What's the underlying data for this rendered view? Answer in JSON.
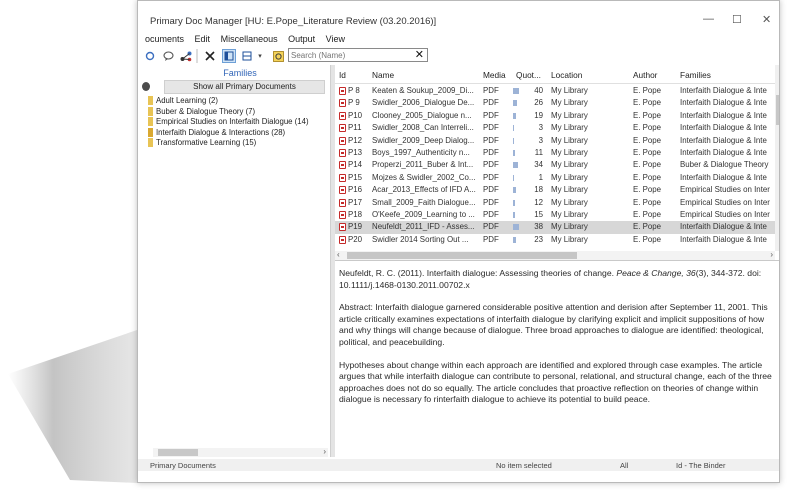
{
  "window": {
    "title": "Primary Doc Manager [HU: E.Pope_Literature Review (03.20.2016)]",
    "controls": {
      "minimize": "—",
      "maximize": "☐",
      "close": "✕"
    }
  },
  "menu": {
    "items": [
      "ocuments",
      "Edit",
      "Miscellaneous",
      "Output",
      "View"
    ]
  },
  "toolbar": {
    "search_placeholder": "Search (Name)",
    "search_clear": "✕",
    "accent": "#3266b8"
  },
  "families": {
    "header": "Families",
    "show_all": "Show all Primary Documents",
    "items": [
      "Adult Learning (2)",
      "Buber & Dialogue Theory (7)",
      "Empirical Studies on Interfaith Dialogue (14)",
      "Interfaith Dialogue & Interactions (28)",
      "Transformative Learning (15)"
    ]
  },
  "grid": {
    "columns": [
      "Id",
      "Name",
      "Media",
      "Quot...",
      "Location",
      "Author",
      "Families"
    ],
    "rows": [
      {
        "id": "P 8",
        "name": "Keaten & Soukup_2009_Di...",
        "media": "PDF",
        "quot": "40",
        "location": "My Library",
        "author": "E. Pope",
        "families": "Interfaith Dialogue & Inte",
        "selected": false
      },
      {
        "id": "P 9",
        "name": "Swidler_2006_Dialogue De...",
        "media": "PDF",
        "quot": "26",
        "location": "My Library",
        "author": "E. Pope",
        "families": "Interfaith Dialogue & Inte",
        "selected": false
      },
      {
        "id": "P10",
        "name": "Clooney_2005_Dialogue n...",
        "media": "PDF",
        "quot": "19",
        "location": "My Library",
        "author": "E. Pope",
        "families": "Interfaith Dialogue & Inte",
        "selected": false
      },
      {
        "id": "P11",
        "name": "Swidler_2008_Can Interreli...",
        "media": "PDF",
        "quot": "3",
        "location": "My Library",
        "author": "E. Pope",
        "families": "Interfaith Dialogue & Inte",
        "selected": false
      },
      {
        "id": "P12",
        "name": "Swidler_2009_Deep Dialog...",
        "media": "PDF",
        "quot": "3",
        "location": "My Library",
        "author": "E. Pope",
        "families": "Interfaith Dialogue & Inte",
        "selected": false
      },
      {
        "id": "P13",
        "name": "Boys_1997_Authenticity n...",
        "media": "PDF",
        "quot": "11",
        "location": "My Library",
        "author": "E. Pope",
        "families": "Interfaith Dialogue & Inte",
        "selected": false
      },
      {
        "id": "P14",
        "name": "Properzi_2011_Buber & Int...",
        "media": "PDF",
        "quot": "34",
        "location": "My Library",
        "author": "E. Pope",
        "families": "Buber & Dialogue Theory",
        "selected": false
      },
      {
        "id": "P15",
        "name": "Mojzes & Swidler_2002_Co...",
        "media": "PDF",
        "quot": "1",
        "location": "My Library",
        "author": "E. Pope",
        "families": "Interfaith Dialogue & Inte",
        "selected": false
      },
      {
        "id": "P16",
        "name": "Acar_2013_Effects of IFD A...",
        "media": "PDF",
        "quot": "18",
        "location": "My Library",
        "author": "E. Pope",
        "families": "Empirical Studies on Inter",
        "selected": false
      },
      {
        "id": "P17",
        "name": "Small_2009_Faith Dialogue...",
        "media": "PDF",
        "quot": "12",
        "location": "My Library",
        "author": "E. Pope",
        "families": "Empirical Studies on Inter",
        "selected": false
      },
      {
        "id": "P18",
        "name": "O'Keefe_2009_Learning to ...",
        "media": "PDF",
        "quot": "15",
        "location": "My Library",
        "author": "E. Pope",
        "families": "Empirical Studies on Inter",
        "selected": false
      },
      {
        "id": "P19",
        "name": "Neufeldt_2011_IFD - Asses...",
        "media": "PDF",
        "quot": "38",
        "location": "My Library",
        "author": "E. Pope",
        "families": "Interfaith Dialogue & Inte",
        "selected": true
      },
      {
        "id": "P20",
        "name": "Swidler 2014 Sorting Out ...",
        "media": "PDF",
        "quot": "23",
        "location": "My Library",
        "author": "E. Pope",
        "families": "Interfaith Dialogue & Inte",
        "selected": false
      }
    ]
  },
  "detail": {
    "citation_a": "Neufeldt, R. C. (2011). Interfaith dialogue: Assessing theories of change. ",
    "citation_journal": "Peace & Change, 36",
    "citation_b": "(3), 344-372. doi: 10.1111/j.1468-0130.2011.00702.x",
    "abstract": "Abstract: Interfaith dialogue garnered considerable positive attention and derision after September 11, 2001. This article critically examines expectations of interfaith dialogue by clarifying explicit and implicit suppositions of how and why things will change because of dialogue. Three broad approaches to dialogue are identified: theological, political, and peacebuilding.",
    "hypotheses": "Hypotheses about change within each approach are identified and explored through case examples. The article argues that while interfaith dialogue can contribute to personal, relational, and structural change, each of the three approaches does not do so equally. The article concludes that proactive reflection on theories of change within dialogue is necessary fo rinterfaith dialogue to achieve its potential to build peace."
  },
  "status": {
    "left": "Primary Documents",
    "mid": "No item selected",
    "right1": "All",
    "right2": "Id - The Binder"
  }
}
